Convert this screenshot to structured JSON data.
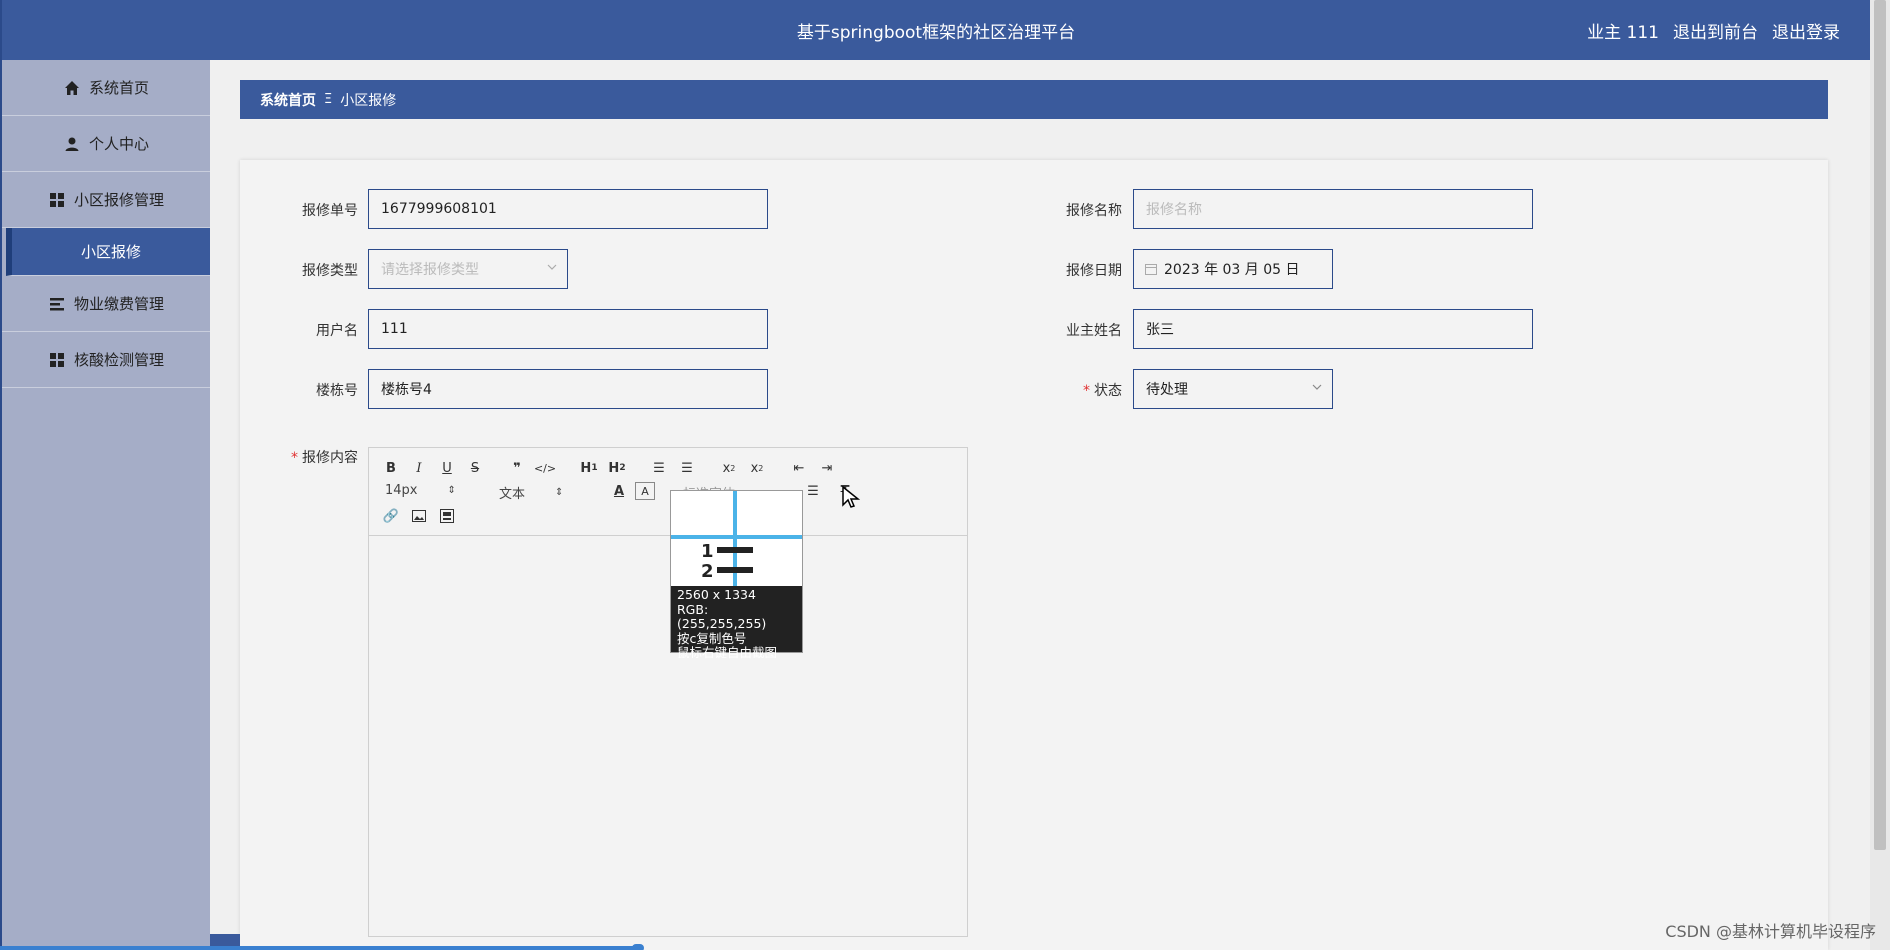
{
  "header": {
    "title": "基于springboot框架的社区治理平台",
    "user": "业主 111",
    "front_link": "退出到前台",
    "logout": "退出登录"
  },
  "sidebar": {
    "items": [
      {
        "label": "系统首页",
        "icon": "home-icon"
      },
      {
        "label": "个人中心",
        "icon": "user-icon"
      },
      {
        "label": "小区报修管理",
        "icon": "grid-icon"
      },
      {
        "label": "小区报修",
        "icon": "",
        "active": true
      },
      {
        "label": "物业缴费管理",
        "icon": "list-icon"
      },
      {
        "label": "核酸检测管理",
        "icon": "grid-icon"
      }
    ]
  },
  "breadcrumb": {
    "home": "系统首页",
    "sep": "Ξ",
    "current": "小区报修"
  },
  "form": {
    "order_no_label": "报修单号",
    "order_no_value": "1677999608101",
    "name_label": "报修名称",
    "name_placeholder": "报修名称",
    "type_label": "报修类型",
    "type_placeholder": "请选择报修类型",
    "date_label": "报修日期",
    "date_value": "2023 年 03 月 05 日",
    "username_label": "用户名",
    "username_value": "111",
    "owner_label": "业主姓名",
    "owner_value": "张三",
    "building_label": "楼栋号",
    "building_value": "楼栋号4",
    "status_label": "状态",
    "status_value": "待处理",
    "content_label": "报修内容"
  },
  "editor": {
    "font_size": "14px",
    "text_style": "文本",
    "font_family": "标准字体"
  },
  "picker": {
    "size": "2560 x 1334",
    "rgb": "RGB:(255,255,255)",
    "hint1": "按c复制色号",
    "hint2": "鼠标右键自由截图"
  },
  "watermark": "CSDN @基林计算机毕设程序"
}
